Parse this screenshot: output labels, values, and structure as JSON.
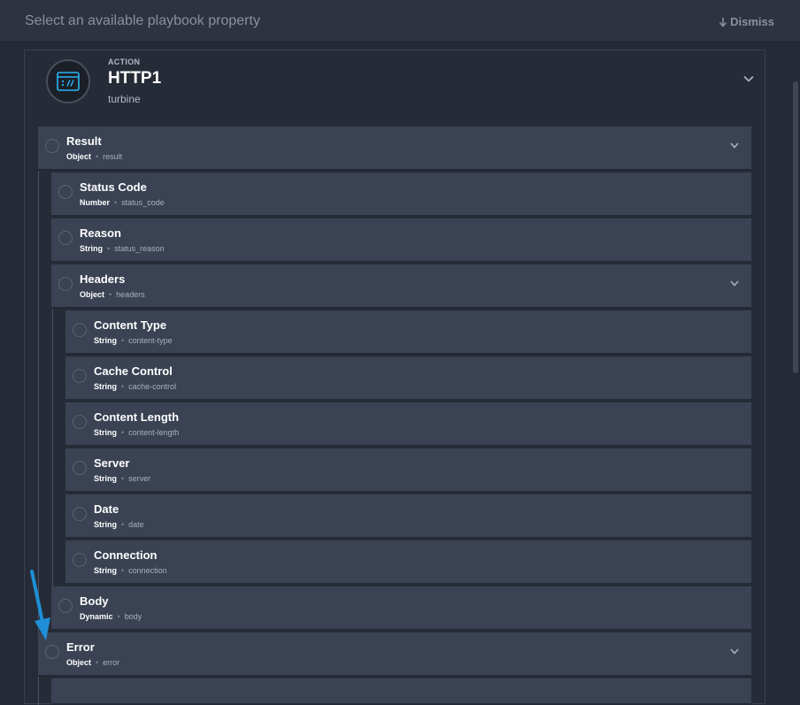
{
  "topbar": {
    "title": "Select an available playbook property",
    "dismiss_label": "Dismiss"
  },
  "action": {
    "kind": "ACTION",
    "name": "HTTP1",
    "subtitle": "turbine",
    "icon": "http-action-icon"
  },
  "properties": {
    "result": {
      "label": "Result",
      "type": "Object",
      "key": "result"
    },
    "status_code": {
      "label": "Status Code",
      "type": "Number",
      "key": "status_code"
    },
    "reason": {
      "label": "Reason",
      "type": "String",
      "key": "status_reason"
    },
    "headers": {
      "label": "Headers",
      "type": "Object",
      "key": "headers"
    },
    "content_type": {
      "label": "Content Type",
      "type": "String",
      "key": "content-type"
    },
    "cache_control": {
      "label": "Cache Control",
      "type": "String",
      "key": "cache-control"
    },
    "content_length": {
      "label": "Content Length",
      "type": "String",
      "key": "content-length"
    },
    "server": {
      "label": "Server",
      "type": "String",
      "key": "server"
    },
    "date": {
      "label": "Date",
      "type": "String",
      "key": "date"
    },
    "connection": {
      "label": "Connection",
      "type": "String",
      "key": "connection"
    },
    "body": {
      "label": "Body",
      "type": "Dynamic",
      "key": "body"
    },
    "error": {
      "label": "Error",
      "type": "Object",
      "key": "error"
    }
  },
  "colors": {
    "background": "#252b36",
    "row": "#3a4253",
    "accent_arrow": "#1e8fd6",
    "icon_accent": "#29b6f6"
  }
}
